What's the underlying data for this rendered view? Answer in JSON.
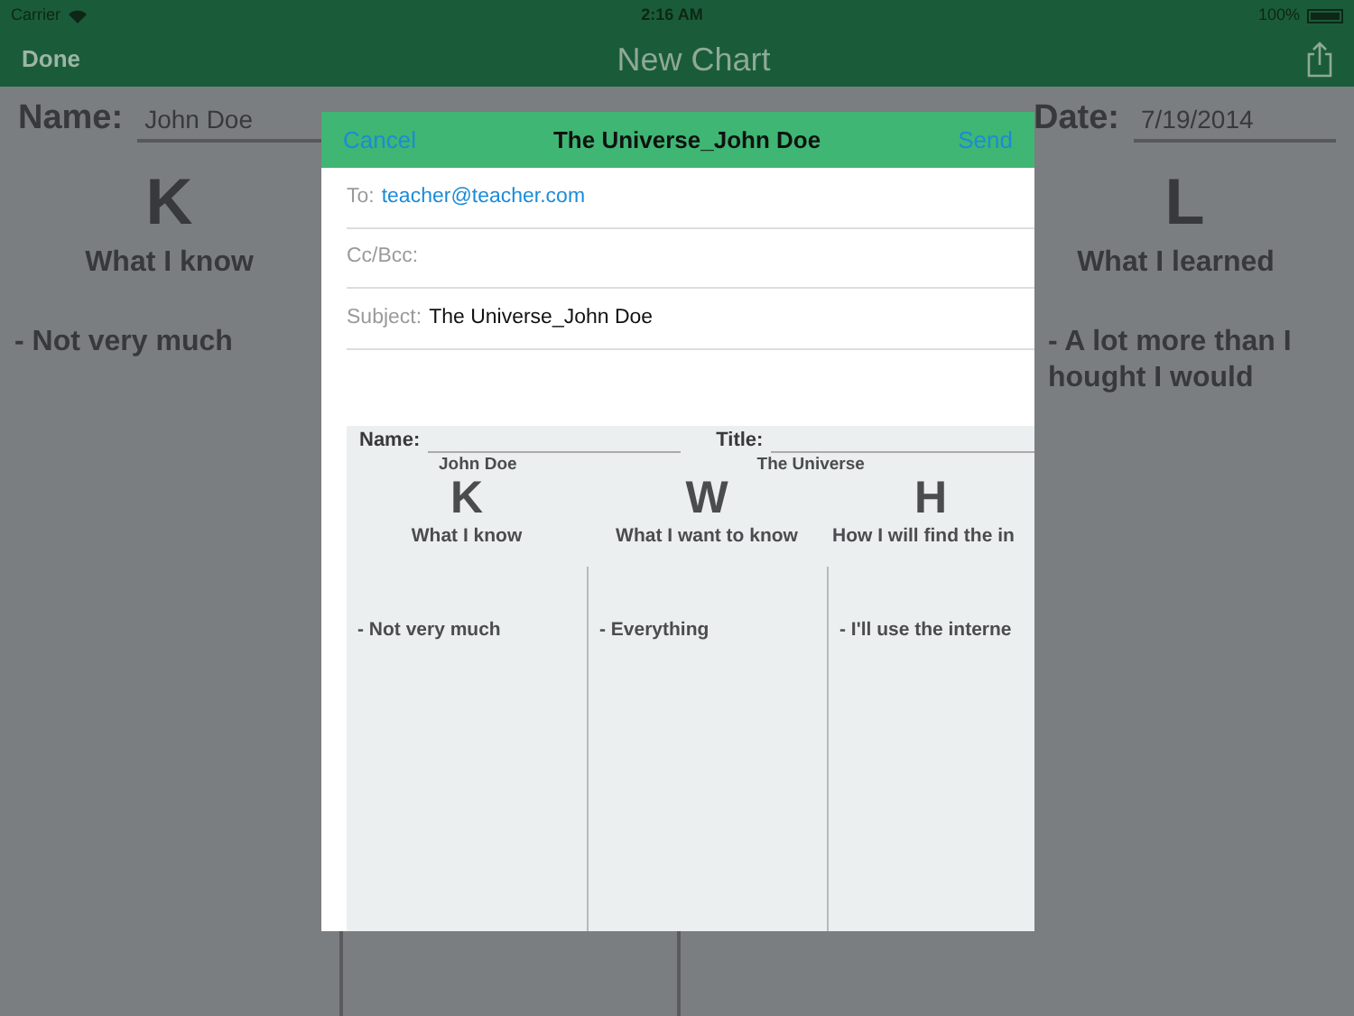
{
  "status_bar": {
    "carrier": "Carrier",
    "time": "2:16 AM",
    "battery": "100%"
  },
  "nav_bar": {
    "left_button": "Done",
    "title": "New Chart"
  },
  "chart": {
    "name_label": "Name:",
    "name": "John Doe",
    "date_label": "Date:",
    "date": "7/19/2014",
    "columns": [
      {
        "letter": "K",
        "heading": "What I know",
        "lines": [
          "- Not very much"
        ]
      },
      {
        "letter": "L",
        "heading": "What I learned",
        "lines": [
          "- A lot more than I",
          "hought I would"
        ]
      }
    ]
  },
  "mail": {
    "cancel": "Cancel",
    "title": "The Universe_John Doe",
    "send": "Send",
    "fields": [
      {
        "kind": "recipient",
        "label": "To:",
        "value": "teacher@teacher.com"
      },
      {
        "kind": "plain",
        "label": "Cc/Bcc:"
      },
      {
        "kind": "plain",
        "label": "Subject:",
        "value": "The Universe_John Doe"
      }
    ],
    "attachment": {
      "name_label": "Name:",
      "name": "John Doe",
      "title_label": "Title:",
      "title": "The Universe",
      "columns": [
        {
          "letter": "K",
          "heading": "What I know",
          "entry": "- Not very much"
        },
        {
          "letter": "W",
          "heading": "What I want to know",
          "entry": "- Everything"
        },
        {
          "letter": "H",
          "heading": "How I will find the in",
          "entry": "- I'll use the interne"
        }
      ]
    }
  }
}
